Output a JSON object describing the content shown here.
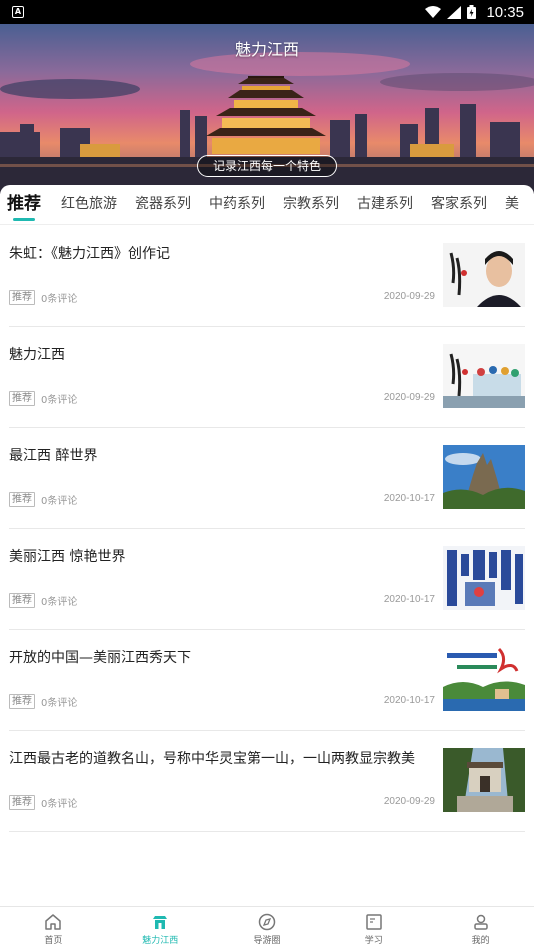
{
  "status_bar": {
    "time": "10:35",
    "icons": [
      "app-notification-icon",
      "wifi-icon",
      "signal-icon",
      "battery-icon"
    ]
  },
  "header": {
    "title": "魅力江西",
    "slogan": "记录江西每一个特色"
  },
  "tabs": [
    {
      "label": "推荐",
      "active": true
    },
    {
      "label": "红色旅游",
      "active": false
    },
    {
      "label": "瓷器系列",
      "active": false
    },
    {
      "label": "中药系列",
      "active": false
    },
    {
      "label": "宗教系列",
      "active": false
    },
    {
      "label": "古建系列",
      "active": false
    },
    {
      "label": "客家系列",
      "active": false
    },
    {
      "label": "美",
      "active": false
    }
  ],
  "articles": [
    {
      "title": "朱虹：《魅力江西》创作记",
      "tag": "推荐",
      "comments": "0条评论",
      "date": "2020-09-29",
      "thumb": "portrait"
    },
    {
      "title": "魅力江西",
      "tag": "推荐",
      "comments": "0条评论",
      "date": "2020-09-29",
      "thumb": "calligraphy"
    },
    {
      "title": "最江西 醉世界",
      "tag": "推荐",
      "comments": "0条评论",
      "date": "2020-10-17",
      "thumb": "mountain"
    },
    {
      "title": "美丽江西 惊艳世界",
      "tag": "推荐",
      "comments": "0条评论",
      "date": "2020-10-17",
      "thumb": "porcelain"
    },
    {
      "title": "开放的中国—美丽江西秀天下",
      "tag": "推荐",
      "comments": "0条评论",
      "date": "2020-10-17",
      "thumb": "poster"
    },
    {
      "title": "江西最古老的道教名山，号称中华灵宝第一山，一山两教显宗教美",
      "tag": "推荐",
      "comments": "0条评论",
      "date": "2020-09-29",
      "thumb": "gate"
    }
  ],
  "bottom_nav": [
    {
      "label": "首页",
      "icon": "home-icon",
      "active": false
    },
    {
      "label": "魅力江西",
      "icon": "pavilion-icon",
      "active": true
    },
    {
      "label": "导游圈",
      "icon": "compass-icon",
      "active": false
    },
    {
      "label": "学习",
      "icon": "book-icon",
      "active": false
    },
    {
      "label": "我的",
      "icon": "user-icon",
      "active": false
    }
  ],
  "colors": {
    "accent": "#1fb9b1",
    "status_bar": "#000000"
  }
}
